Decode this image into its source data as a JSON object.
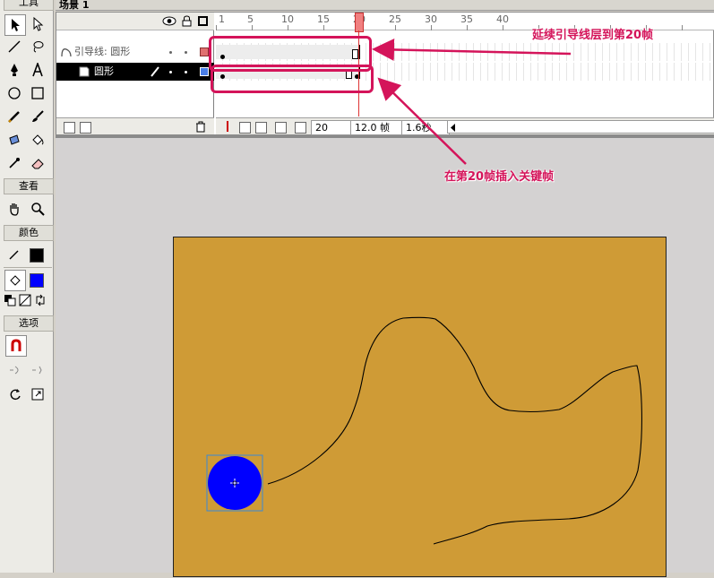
{
  "tools": {
    "header_label": "工具",
    "view_label": "查看",
    "colors_label": "颜色",
    "options_label": "选项",
    "stroke_color": "#000000",
    "fill_color": "#0000ff"
  },
  "scene": {
    "title": "场景 1"
  },
  "timeline": {
    "ruler_numbers": [
      "1",
      "5",
      "10",
      "15",
      "20",
      "25",
      "30",
      "35",
      "40"
    ],
    "layers": [
      {
        "name": "引导线: 圆形",
        "type": "guide",
        "color": "#e07070"
      },
      {
        "name": "圆形",
        "type": "normal",
        "color": "#4a7ee8",
        "active": true
      }
    ],
    "current_frame": "20",
    "frame_rate": "12.0 帧",
    "elapsed": "1.6秒"
  },
  "stage": {
    "background": "#cf9b36",
    "circle_color": "#0000ff"
  },
  "annotations": {
    "extend_guide": "延续引导线层到第20帧",
    "insert_keyframe": "在第20帧插入关键帧"
  }
}
